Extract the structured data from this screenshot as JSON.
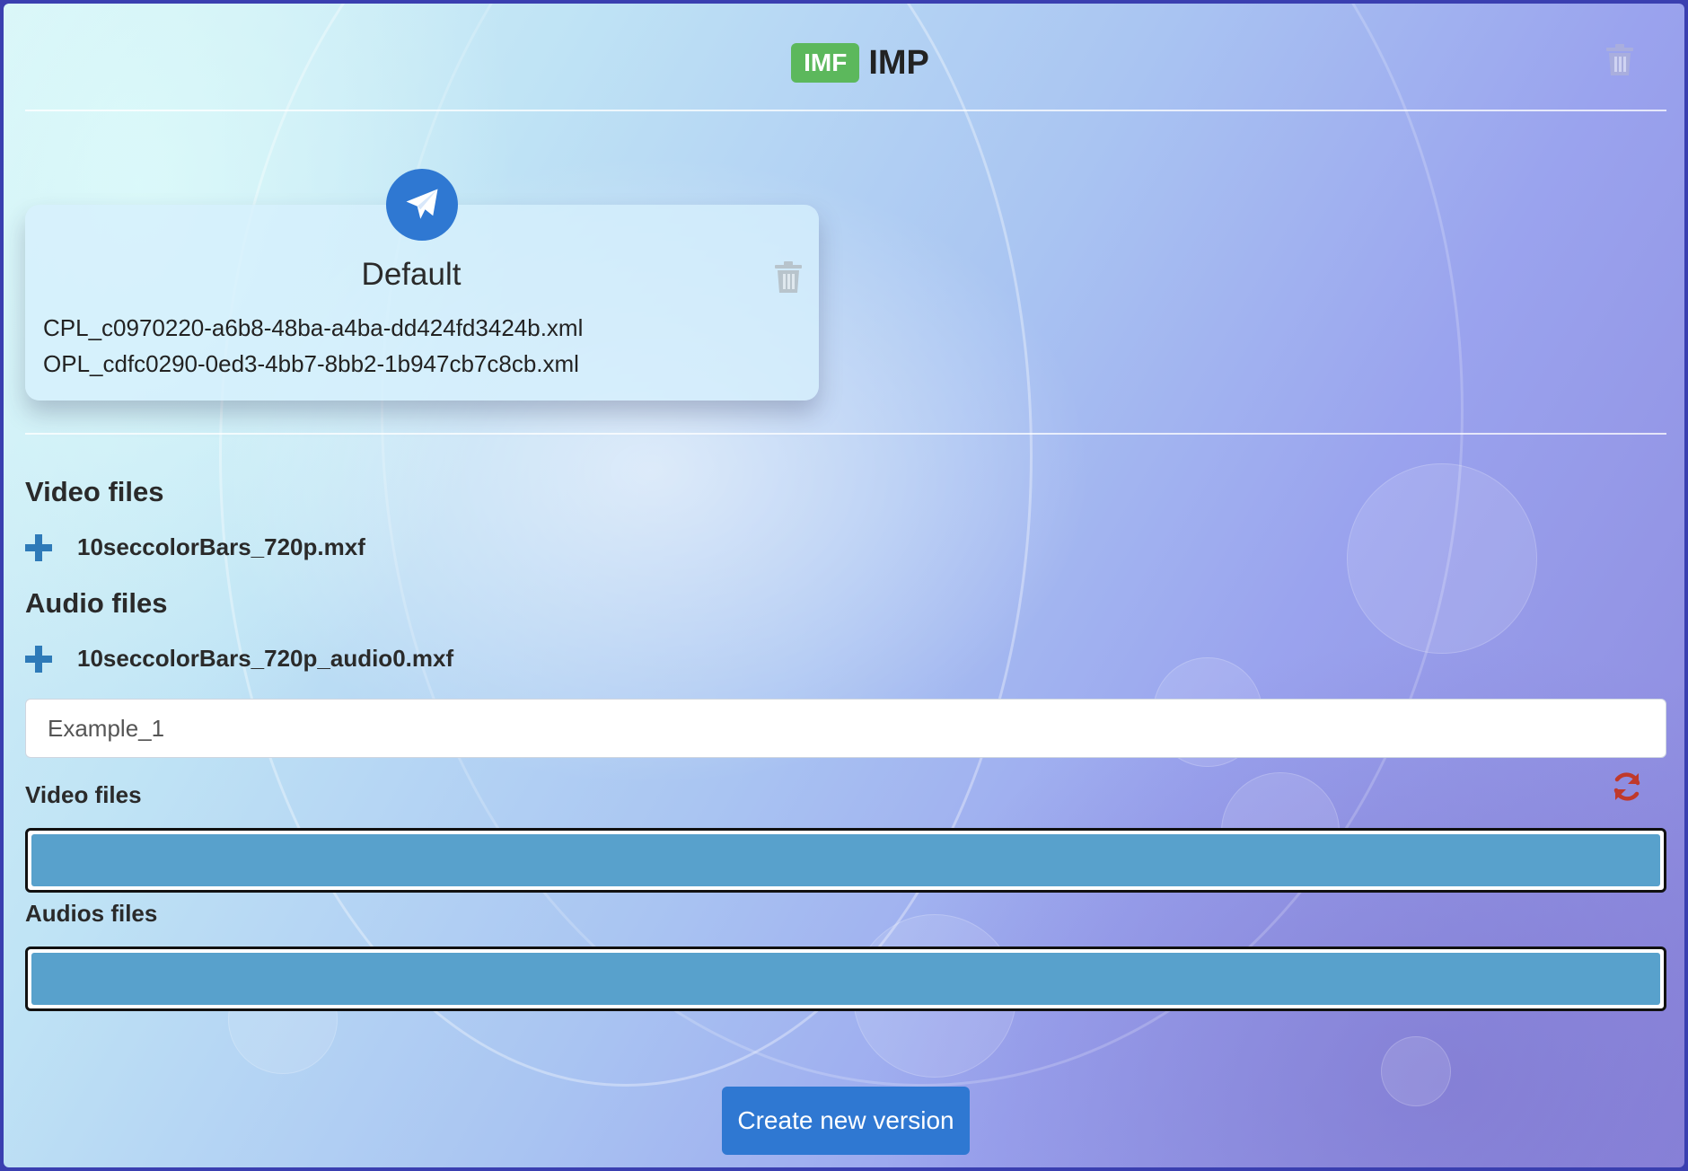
{
  "header": {
    "badge": "IMF",
    "title": "IMP",
    "trash_icon": "trash-icon"
  },
  "composition": {
    "icon": "paper-plane-icon",
    "title": "Default",
    "files": [
      "CPL_c0970220-a6b8-48ba-a4ba-dd424fd3424b.xml",
      "OPL_cdfc0290-0ed3-4bb7-8bb2-1b947cb7c8cb.xml"
    ]
  },
  "sources": {
    "video_heading": "Video files",
    "video_files": [
      "10seccolorBars_720p.mxf"
    ],
    "audio_heading": "Audio files",
    "audio_files": [
      "10seccolorBars_720p_audio0.mxf"
    ]
  },
  "version": {
    "name_value": "Example_1",
    "video_label": "Video files",
    "audio_label": "Audios files"
  },
  "actions": {
    "create_label": "Create new version"
  },
  "colors": {
    "accent": "#2f78d2",
    "badge": "#5cb85c",
    "dropzone_fill": "#58a1cc",
    "refresh": "#c0392b"
  }
}
